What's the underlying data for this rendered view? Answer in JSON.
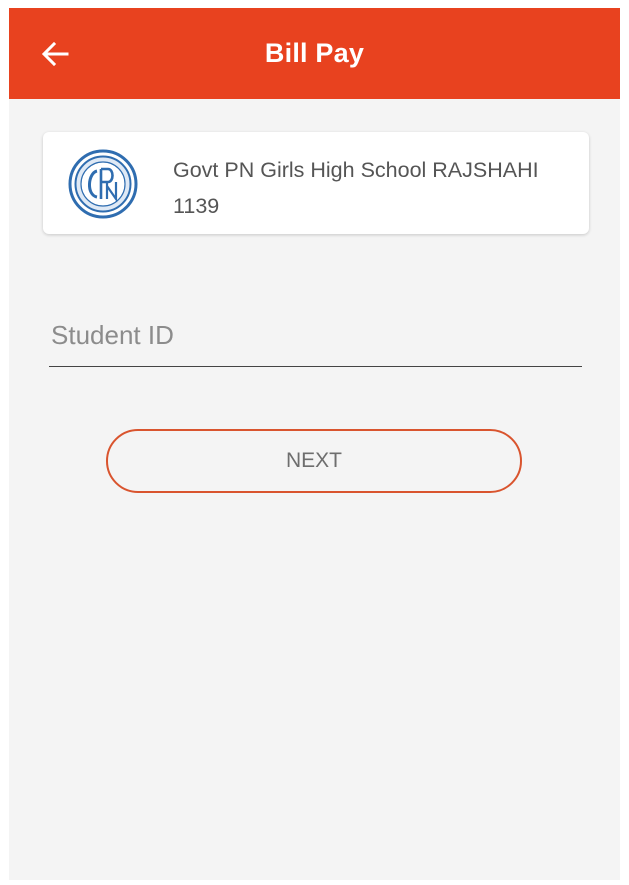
{
  "app_bar": {
    "title": "Bill Pay",
    "back_icon": "arrow-left-icon",
    "background_color": "#e8421f"
  },
  "school": {
    "name": "Govt PN Girls High School RAJSHAHI",
    "code": "1139",
    "logo_icon": "school-crest-icon",
    "logo_letters": "GPN"
  },
  "form": {
    "student_id": {
      "placeholder": "Student ID",
      "value": ""
    }
  },
  "actions": {
    "next_label": "NEXT",
    "accent_color": "#d9542e"
  }
}
